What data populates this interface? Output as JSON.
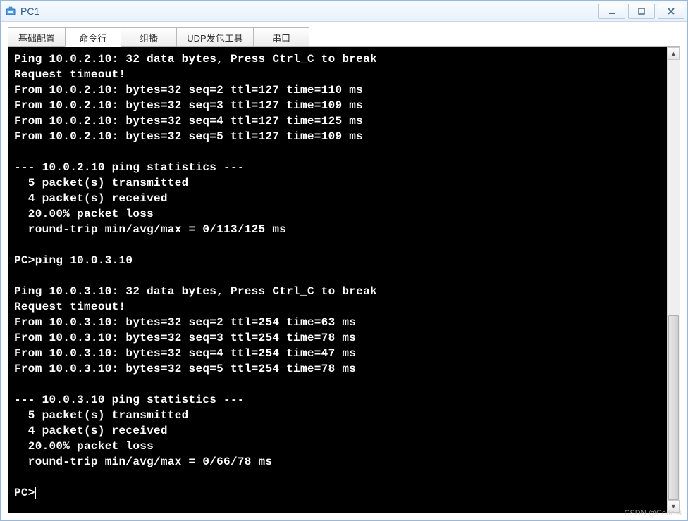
{
  "window": {
    "title": "PC1"
  },
  "tabs": [
    {
      "label": "基础配置"
    },
    {
      "label": "命令行"
    },
    {
      "label": "组播"
    },
    {
      "label": "UDP发包工具"
    },
    {
      "label": "串口"
    }
  ],
  "scrollbar": {
    "up_glyph": "▲",
    "down_glyph": "▼",
    "thumb_top_pct": 58,
    "thumb_height_pct": 42
  },
  "terminal": {
    "lines": [
      "Ping 10.0.2.10: 32 data bytes, Press Ctrl_C to break",
      "Request timeout!",
      "From 10.0.2.10: bytes=32 seq=2 ttl=127 time=110 ms",
      "From 10.0.2.10: bytes=32 seq=3 ttl=127 time=109 ms",
      "From 10.0.2.10: bytes=32 seq=4 ttl=127 time=125 ms",
      "From 10.0.2.10: bytes=32 seq=5 ttl=127 time=109 ms",
      "",
      "--- 10.0.2.10 ping statistics ---",
      "  5 packet(s) transmitted",
      "  4 packet(s) received",
      "  20.00% packet loss",
      "  round-trip min/avg/max = 0/113/125 ms",
      "",
      "PC>ping 10.0.3.10",
      "",
      "Ping 10.0.3.10: 32 data bytes, Press Ctrl_C to break",
      "Request timeout!",
      "From 10.0.3.10: bytes=32 seq=2 ttl=254 time=63 ms",
      "From 10.0.3.10: bytes=32 seq=3 ttl=254 time=78 ms",
      "From 10.0.3.10: bytes=32 seq=4 ttl=254 time=47 ms",
      "From 10.0.3.10: bytes=32 seq=5 ttl=254 time=78 ms",
      "",
      "--- 10.0.3.10 ping statistics ---",
      "  5 packet(s) transmitted",
      "  4 packet(s) received",
      "  20.00% packet loss",
      "  round-trip min/avg/max = 0/66/78 ms",
      ""
    ],
    "prompt": "PC>"
  },
  "watermark": "CSDN @Code-4"
}
